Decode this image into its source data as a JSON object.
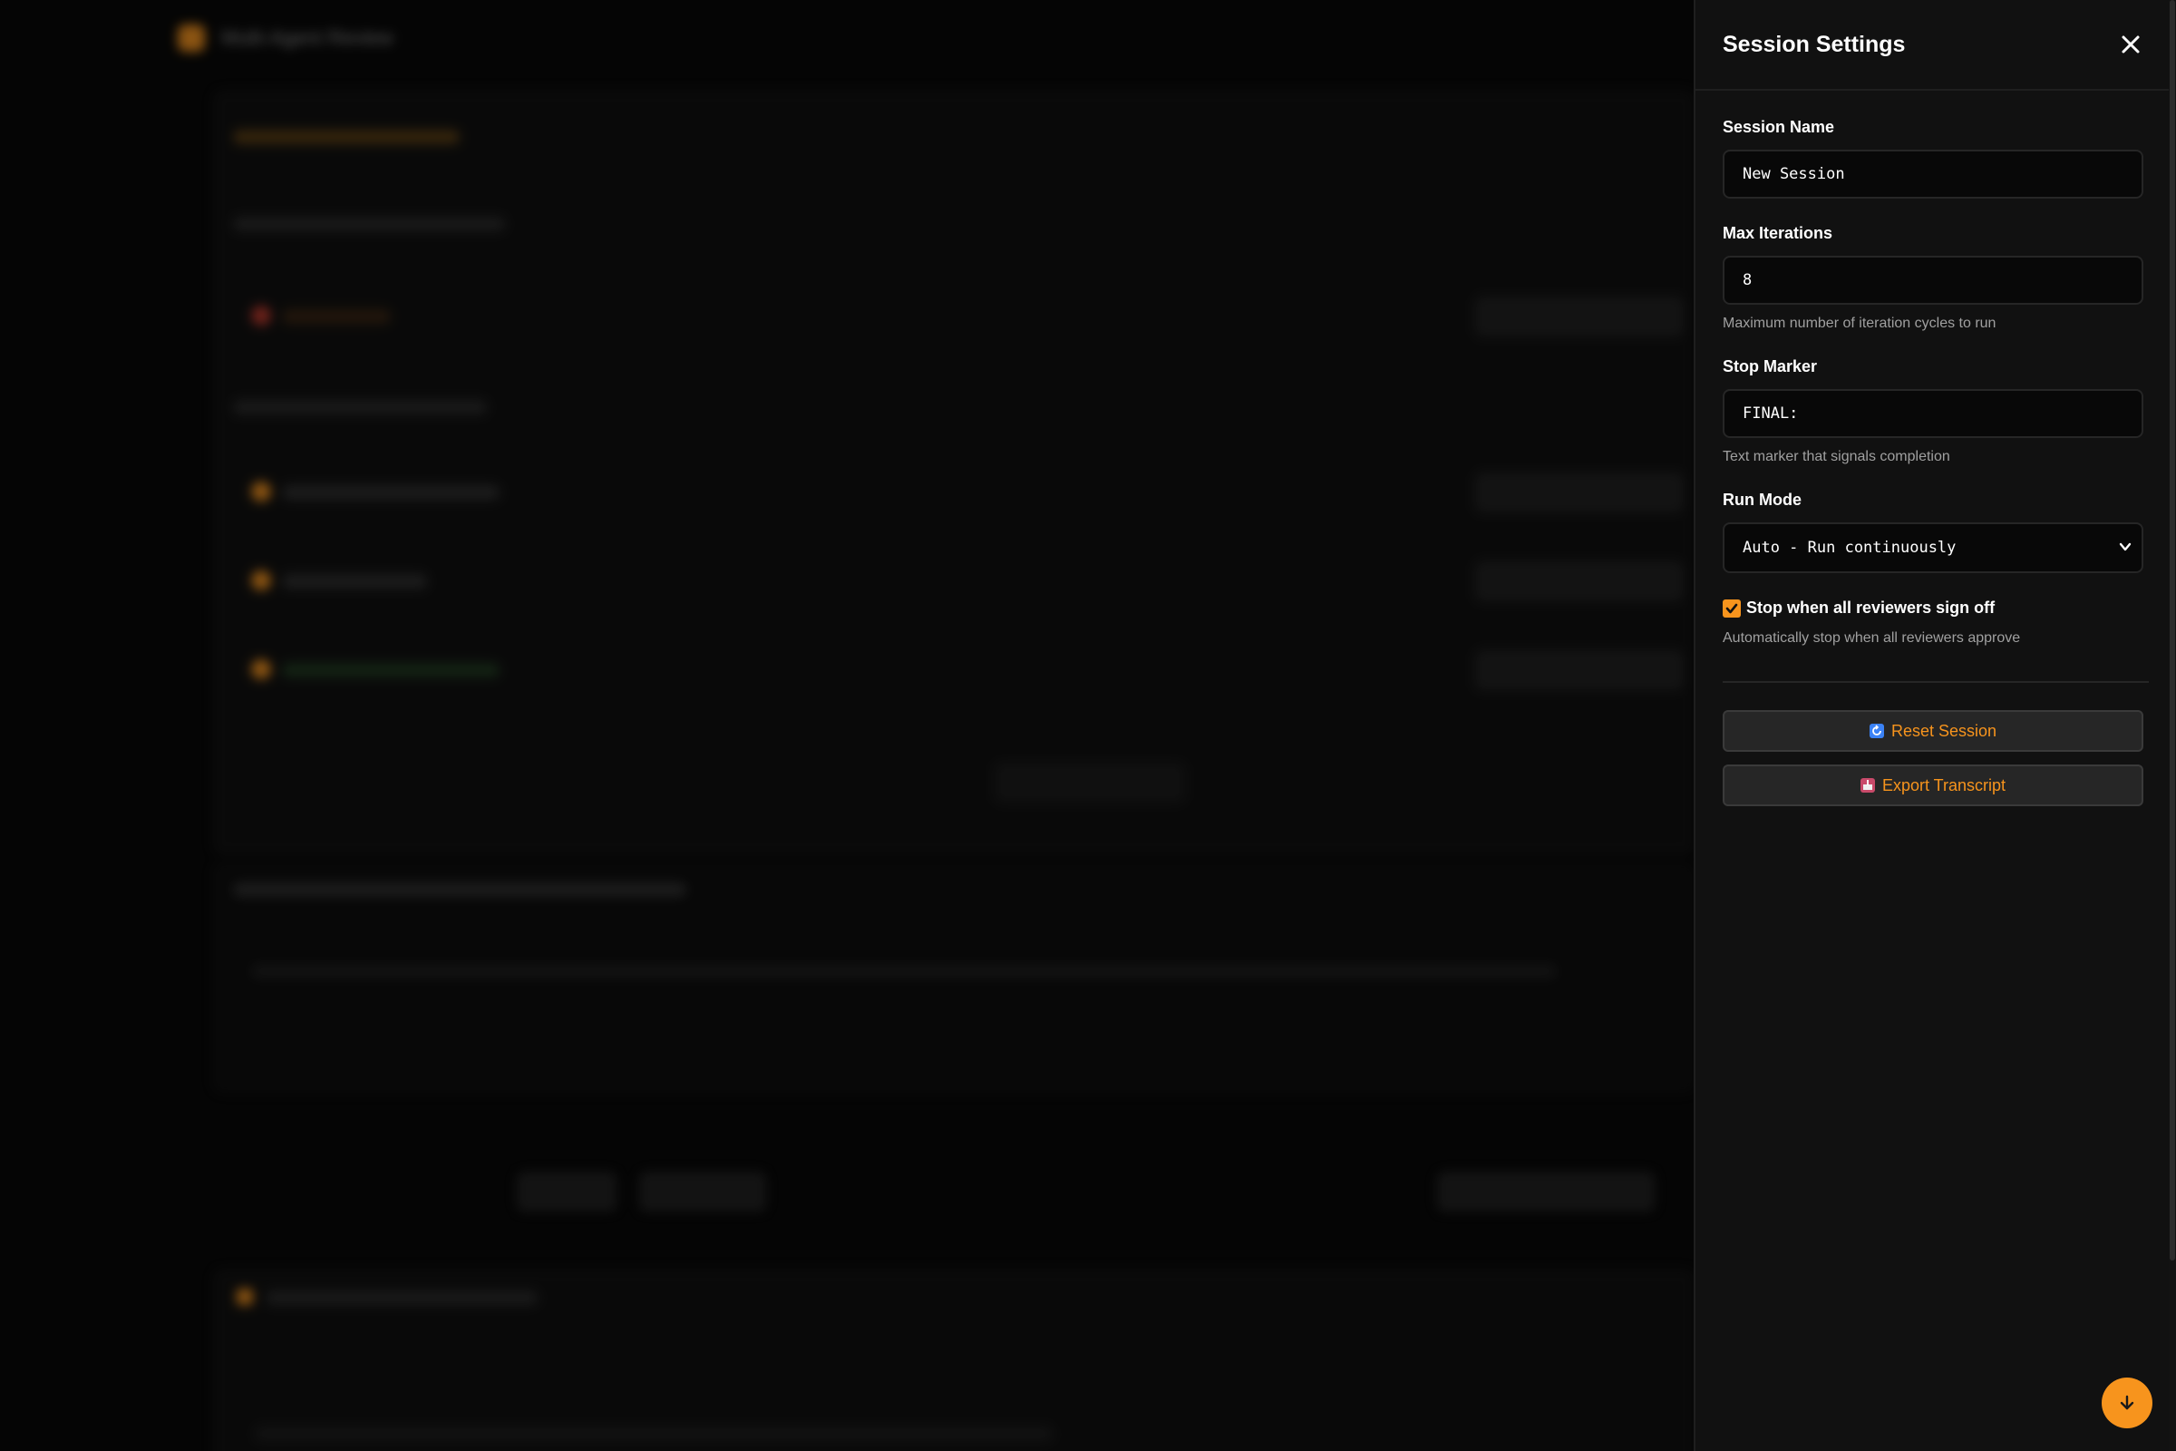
{
  "background": {
    "app_title": "Multi-Agent Review"
  },
  "drawer": {
    "title": "Session Settings",
    "fields": {
      "session_name": {
        "label": "Session Name",
        "value": "New Session"
      },
      "max_iterations": {
        "label": "Max Iterations",
        "value": "8",
        "hint": "Maximum number of iteration cycles to run"
      },
      "stop_marker": {
        "label": "Stop Marker",
        "value": "FINAL:",
        "hint": "Text marker that signals completion"
      },
      "run_mode": {
        "label": "Run Mode",
        "selected": "Auto - Run continuously"
      }
    },
    "auto_stop": {
      "label": "Stop when all reviewers sign off",
      "hint": "Automatically stop when all reviewers approve",
      "checked": true
    },
    "reset_label": "Reset Session",
    "export_label": "Export Transcript"
  },
  "colors": {
    "accent": "#f7941d",
    "panel_bg": "#111111",
    "input_bg": "#080808",
    "border": "#262626",
    "reset_icon": "#3b82f6",
    "export_icon": "#c94a6a"
  },
  "icons": {
    "close": "close-icon",
    "select_chevron": "chevron-down-icon",
    "checkbox": "check-icon",
    "reset": "refresh-icon",
    "export": "export-icon",
    "scroll_down": "arrow-down-icon"
  }
}
